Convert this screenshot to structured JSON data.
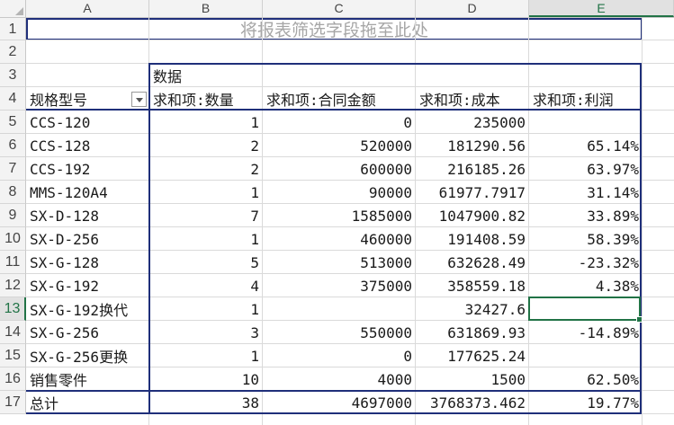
{
  "columns": [
    "A",
    "B",
    "C",
    "D",
    "E"
  ],
  "selected_column": "E",
  "rows": [
    "1",
    "2",
    "3",
    "4",
    "5",
    "6",
    "7",
    "8",
    "9",
    "10",
    "11",
    "12",
    "13",
    "14",
    "15",
    "16",
    "17"
  ],
  "selected_row": "13",
  "pivot": {
    "filter_placeholder": "将报表筛选字段拖至此处",
    "data_label": "数据",
    "row_field_header": "规格型号",
    "value_headers": [
      "求和项:数量",
      "求和项:合同金额",
      "求和项:成本",
      "求和项:利润"
    ],
    "records": [
      [
        "CCS-120",
        "1",
        "0",
        "235000",
        ""
      ],
      [
        "CCS-128",
        "2",
        "520000",
        "181290.56",
        "65.14%"
      ],
      [
        "CCS-192",
        "2",
        "600000",
        "216185.26",
        "63.97%"
      ],
      [
        "MMS-120A4",
        "1",
        "90000",
        "61977.7917",
        "31.14%"
      ],
      [
        "SX-D-128",
        "7",
        "1585000",
        "1047900.82",
        "33.89%"
      ],
      [
        "SX-D-256",
        "1",
        "460000",
        "191408.59",
        "58.39%"
      ],
      [
        "SX-G-128",
        "5",
        "513000",
        "632628.49",
        "-23.32%"
      ],
      [
        "SX-G-192",
        "4",
        "375000",
        "358559.18",
        "4.38%"
      ],
      [
        "SX-G-192换代",
        "1",
        "",
        "32427.6",
        ""
      ],
      [
        "SX-G-256",
        "3",
        "550000",
        "631869.93",
        "-14.89%"
      ],
      [
        "SX-G-256更换",
        "1",
        "0",
        "177625.24",
        ""
      ],
      [
        "销售零件",
        "10",
        "4000",
        "1500",
        "62.50%"
      ],
      [
        "总计",
        "38",
        "4697000",
        "3768373.462",
        "19.77%"
      ]
    ]
  }
}
